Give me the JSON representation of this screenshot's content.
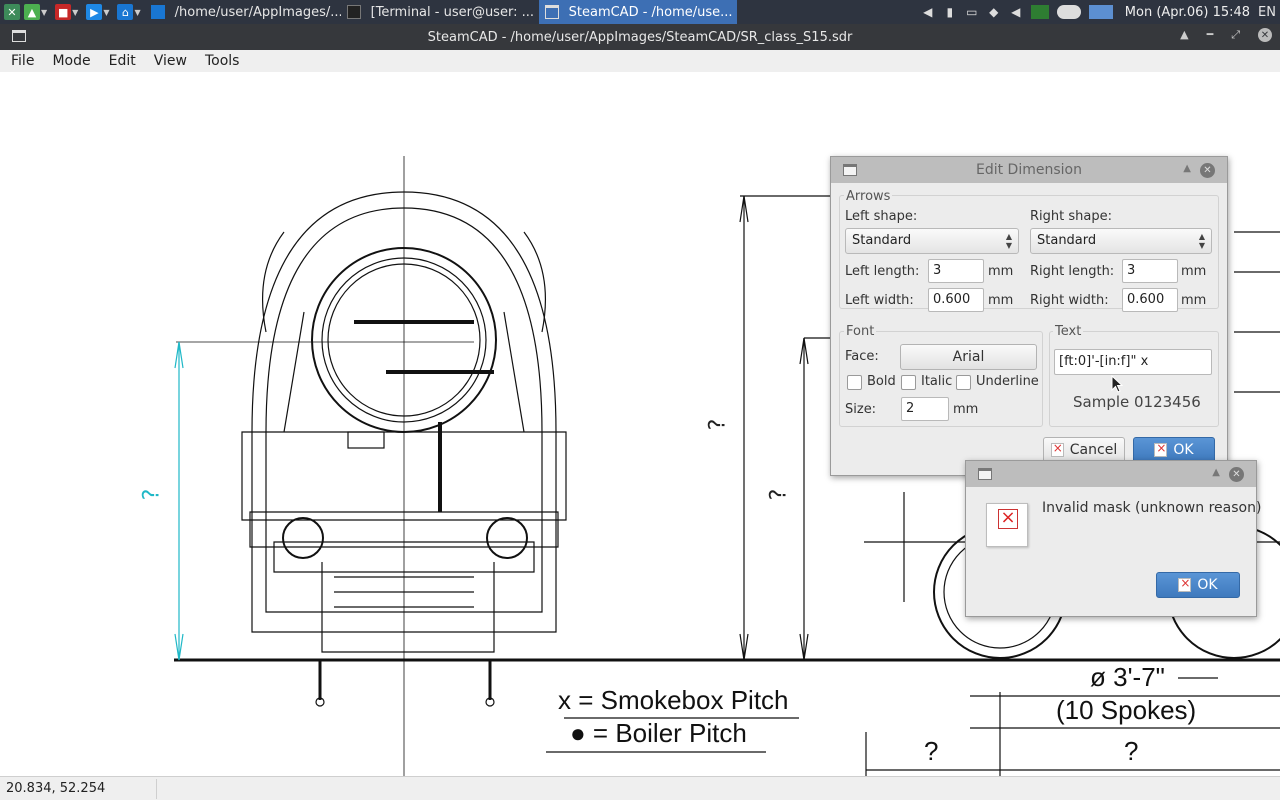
{
  "taskbar": {
    "tasks": [
      {
        "label": "/home/user/AppImages/...",
        "active": false
      },
      {
        "label": "[Terminal - user@user: ...",
        "active": false
      },
      {
        "label": "SteamCAD - /home/use...",
        "active": true
      }
    ],
    "clock": "Mon (Apr.06) 15:48",
    "language": "EN"
  },
  "window": {
    "title": "SteamCAD - /home/user/AppImages/SteamCAD/SR_class_S15.sdr"
  },
  "menu": [
    "File",
    "Mode",
    "Edit",
    "View",
    "Tools"
  ],
  "drawing": {
    "labels": {
      "smokebox": "x = Smokebox Pitch",
      "boiler": "● = Boiler Pitch",
      "diameter": "ø 3'-7\"",
      "spokes": "(10 Spokes)",
      "unknown": "?"
    }
  },
  "statusbar": {
    "coords": "20.834, 52.254"
  },
  "edit_dimension": {
    "title": "Edit Dimension",
    "arrows_group": "Arrows",
    "left_shape_label": "Left shape:",
    "right_shape_label": "Right shape:",
    "left_shape_value": "Standard",
    "right_shape_value": "Standard",
    "left_length_label": "Left length:",
    "right_length_label": "Right length:",
    "left_length_value": "3",
    "right_length_value": "3",
    "left_width_label": "Left width:",
    "right_width_label": "Right width:",
    "left_width_value": "0.600",
    "right_width_value": "0.600",
    "unit": "mm",
    "font_group": "Font",
    "face_label": "Face:",
    "face_value": "Arial",
    "bold_label": "Bold",
    "italic_label": "Italic",
    "underline_label": "Underline",
    "size_label": "Size:",
    "size_value": "2",
    "text_group": "Text",
    "text_value": "[ft:0]'-[in:f]\" x",
    "sample": "Sample 0123456",
    "cancel_label": "Cancel",
    "ok_label": "OK"
  },
  "error_dialog": {
    "message": "Invalid mask (unknown reason)",
    "ok_label": "OK"
  },
  "colors": {
    "taskbar_bg": "#2e3440",
    "active_task": "#3d6fb4",
    "dimension_highlight": "#1fb8c7",
    "primary_button": "#4a86c8"
  }
}
